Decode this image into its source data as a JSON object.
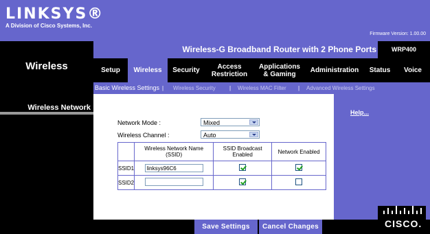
{
  "brand": {
    "logo": "LINKSYS®",
    "subtitle": "A Division of Cisco Systems, Inc.",
    "firmware": "Firmware Version: 1.00.00"
  },
  "product": {
    "title": "Wireless-G Broadband Router with 2 Phone Ports",
    "model": "WRP400"
  },
  "section": {
    "title": "Wireless",
    "subsection": "Wireless Network"
  },
  "tabs": [
    {
      "label": "Setup"
    },
    {
      "label": "Wireless"
    },
    {
      "label": "Security"
    },
    {
      "label": "Access Restriction"
    },
    {
      "label": "Applications & Gaming"
    },
    {
      "label": "Administration"
    },
    {
      "label": "Status"
    },
    {
      "label": "Voice"
    }
  ],
  "subtabs": [
    {
      "label": "Basic Wireless Settings"
    },
    {
      "label": "Wireless Security"
    },
    {
      "label": "Wireless MAC Filter"
    },
    {
      "label": "Advanced Wireless Settings"
    }
  ],
  "separator": "|",
  "form": {
    "network_mode_label": "Network Mode :",
    "network_mode_value": "Mixed",
    "channel_label": "Wireless Channel :",
    "channel_value": "Auto"
  },
  "ssid_table": {
    "headers": [
      "Wireless Network Name (SSID)",
      "SSID Broadcast Enabled",
      "Network Enabled"
    ],
    "rows": [
      {
        "label": "SSID1",
        "name": "linksys96C6",
        "broadcast": true,
        "enabled": true
      },
      {
        "label": "SSID2",
        "name": "",
        "broadcast": true,
        "enabled": false
      }
    ]
  },
  "help": "Help...",
  "buttons": {
    "save": "Save Settings",
    "cancel": "Cancel Changes"
  },
  "footer_logo": "CISCO."
}
